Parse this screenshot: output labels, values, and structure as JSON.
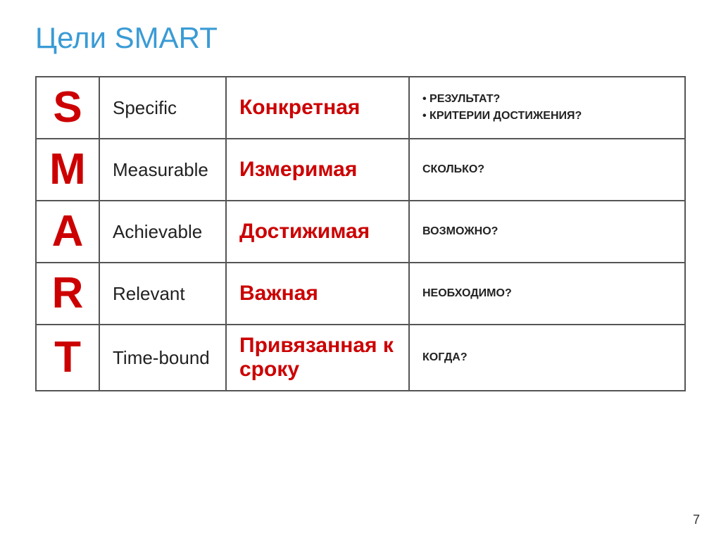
{
  "title": "Цели SMART",
  "table": {
    "rows": [
      {
        "letter": "S",
        "english": "Specific",
        "russian": "Конкретная",
        "description": "• РЕЗУЛЬТАТ?\n• КРИТЕРИИ ДОСТИЖЕНИЯ?"
      },
      {
        "letter": "M",
        "english": "Measurable",
        "russian": "Измеримая",
        "description": "СКОЛЬКО?"
      },
      {
        "letter": "A",
        "english": "Achievable",
        "russian": "Достижимая",
        "description": "ВОЗМОЖНО?"
      },
      {
        "letter": "R",
        "english": "Relevant",
        "russian": "Важная",
        "description": "НЕОБХОДИМО?"
      },
      {
        "letter": "T",
        "english": "Time-bound",
        "russian": "Привязанная к сроку",
        "description": "КОГДА?"
      }
    ]
  },
  "page_number": "7"
}
